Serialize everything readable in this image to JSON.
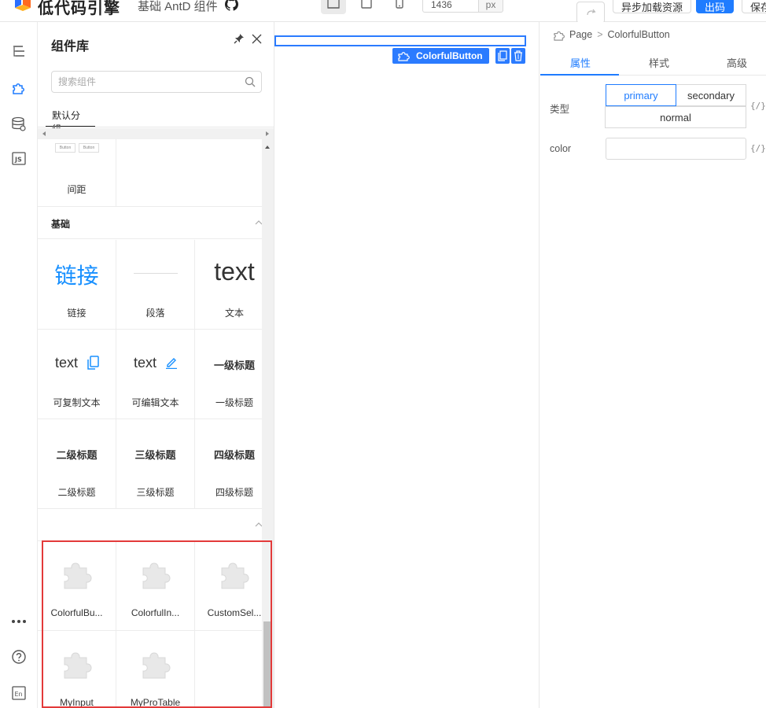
{
  "topbar": {
    "logo_text": "低代码引擎",
    "subtitle": "基础 AntD 组件",
    "width_value": "1436",
    "width_unit": "px",
    "buttons": {
      "async_load": "异步加载资源",
      "publish": "出码",
      "save": "保存"
    }
  },
  "component_panel": {
    "title": "组件库",
    "search_placeholder": "搜索组件",
    "group_tab": "默认分组",
    "spacing_item": {
      "label": "间距",
      "preview_button_1": "Button",
      "preview_button_2": "Button"
    },
    "basic_section": {
      "title": "基础",
      "items": [
        {
          "label": "链接",
          "preview": "链接"
        },
        {
          "label": "段落",
          "preview": ""
        },
        {
          "label": "文本",
          "preview": "text"
        },
        {
          "label": "可复制文本",
          "preview": "text"
        },
        {
          "label": "可编辑文本",
          "preview": "text"
        },
        {
          "label": "一级标题",
          "preview": "一级标题"
        },
        {
          "label": "二级标题",
          "preview": "二级标题"
        },
        {
          "label": "三级标题",
          "preview": "三级标题"
        },
        {
          "label": "四级标题",
          "preview": "四级标题"
        }
      ]
    },
    "custom_section": {
      "items": [
        {
          "label": "ColorfulBu..."
        },
        {
          "label": "ColorfulIn..."
        },
        {
          "label": "CustomSel..."
        },
        {
          "label": "MyInput"
        },
        {
          "label": "MyProTable"
        }
      ]
    }
  },
  "canvas": {
    "selected_component": "ColorfulButton"
  },
  "settings": {
    "breadcrumb": [
      "Page",
      "ColorfulButton"
    ],
    "tabs": [
      "属性",
      "样式",
      "高级"
    ],
    "active_tab": "属性",
    "fields": {
      "type_label": "类型",
      "type_options": [
        "primary",
        "secondary",
        "normal"
      ],
      "type_selected": "primary",
      "color_label": "color",
      "color_value": "",
      "variable_button": "{/}"
    }
  },
  "colors": {
    "accent": "#1f7cff",
    "highlight_border": "#e33a3a",
    "link_blue": "#1890ff"
  }
}
